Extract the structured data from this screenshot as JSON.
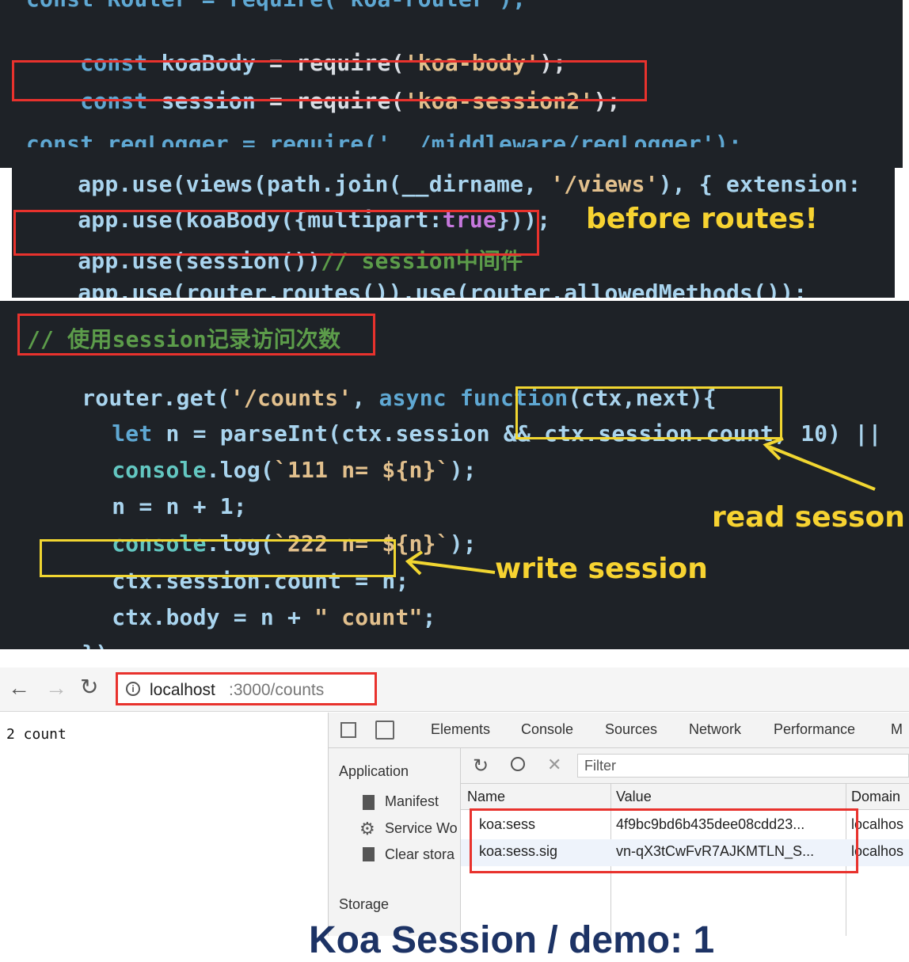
{
  "code1": {
    "line0": "const Router = require('koa-router');",
    "line1_kw": "const",
    "line1_id": "koaBody",
    "line1_op": " = require(",
    "line1_str": "'koa-body'",
    "line1_end": ");",
    "line2_kw": "const",
    "line2_id": "session",
    "line2_op": " = require(",
    "line2_str": "'koa-session2'",
    "line2_end": ");",
    "line3": "const reqLogger = require('../middleware/reqLogger');"
  },
  "code2": {
    "line1_a": "app.use(views(path.join(__dirname, ",
    "line1_str": "'/views'",
    "line1_b": "), { extension:",
    "line2_a": "app.use(koaBody({multipart:",
    "line2_bool": "true",
    "line2_b": "}));",
    "line3_a": "app.use(session())",
    "line3_cm": "// session中间件",
    "line4": "app.use(router.routes()).use(router.allowedMethods());",
    "note": "before routes!"
  },
  "code3": {
    "comment": "// 使用session记录访问次数",
    "l1_a": "router.get(",
    "l1_str": "'/counts'",
    "l1_b": ", ",
    "l1_kw": "async function",
    "l1_c": "(ctx,next){",
    "l2_kw": "let",
    "l2_a": " n = parseInt(ctx.session && ",
    "l2_box": "ctx.session.count",
    "l2_b": ", 10) ||",
    "l3_fn": "console",
    "l3_a": ".log(",
    "l3_str": "`111 n= ${n}`",
    "l3_b": ");",
    "l4": "n = n + 1;",
    "l5_fn": "console",
    "l5_a": ".log(",
    "l5_str": "`222 n= ${n}`",
    "l5_b": ");",
    "l6": "ctx.session.count = n;",
    "l7_a": "ctx.body = n + ",
    "l7_str": "\" count\"",
    "l7_b": ";",
    "l8": "})",
    "note_read": "read sesson",
    "note_write": "write session"
  },
  "browser": {
    "url_host": "localhost",
    "url_path": ":3000/counts",
    "page_text": "2 count",
    "tabs": [
      "Elements",
      "Console",
      "Sources",
      "Network",
      "Performance",
      "M"
    ],
    "filter_placeholder": "Filter",
    "sidebar": {
      "application": "Application",
      "manifest": "Manifest",
      "service_workers": "Service Wo",
      "clear_storage": "Clear stora",
      "storage": "Storage"
    },
    "table": {
      "headers": [
        "Name",
        "Value",
        "Domain"
      ],
      "rows": [
        {
          "name": "koa:sess",
          "value": "4f9bc9bd6b435dee08cdd23...",
          "domain": "localhos"
        },
        {
          "name": "koa:sess.sig",
          "value": "vn-qX3tCwFvR7AJKMTLN_S...",
          "domain": "localhos"
        }
      ]
    }
  },
  "footer_text": "Koa Session / demo: 1"
}
